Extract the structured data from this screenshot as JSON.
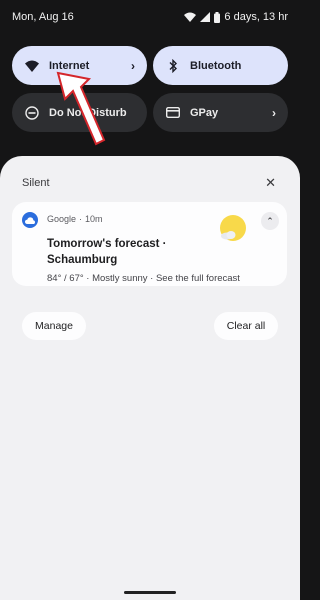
{
  "status_bar": {
    "datetime": "Mon, Aug 16",
    "battery_text": "6 days, 13 hr",
    "icons": [
      "wifi-icon",
      "signal-icon",
      "battery-icon"
    ]
  },
  "quick_settings": {
    "tiles": [
      {
        "label": "Internet",
        "icon": "wifi-icon",
        "state": "on",
        "has_chevron": true
      },
      {
        "label": "Bluetooth",
        "icon": "bluetooth-icon",
        "state": "on",
        "has_chevron": false
      },
      {
        "label": "Do Not Disturb",
        "icon": "do-not-disturb-icon",
        "state": "off",
        "has_chevron": false
      },
      {
        "label": "GPay",
        "icon": "wallet-card-icon",
        "state": "off",
        "has_chevron": true
      }
    ]
  },
  "shade": {
    "section_label": "Silent",
    "close_glyph": "✕",
    "notification": {
      "app": "Google",
      "separator": "·",
      "time": "10m",
      "title": "Tomorrow's forecast · Schaumburg",
      "body": "84° / 67° · Mostly sunny · See the full forecast",
      "expand_glyph": "⌃"
    },
    "actions": {
      "manage": "Manage",
      "clear_all": "Clear all"
    }
  },
  "colors": {
    "background": "#151516",
    "tile_on": "#dde3fb",
    "tile_off": "#2d2e31",
    "shade": "#f1f1f3",
    "annotation_arrow": "#d4262b",
    "sun": "#f8d94a"
  }
}
